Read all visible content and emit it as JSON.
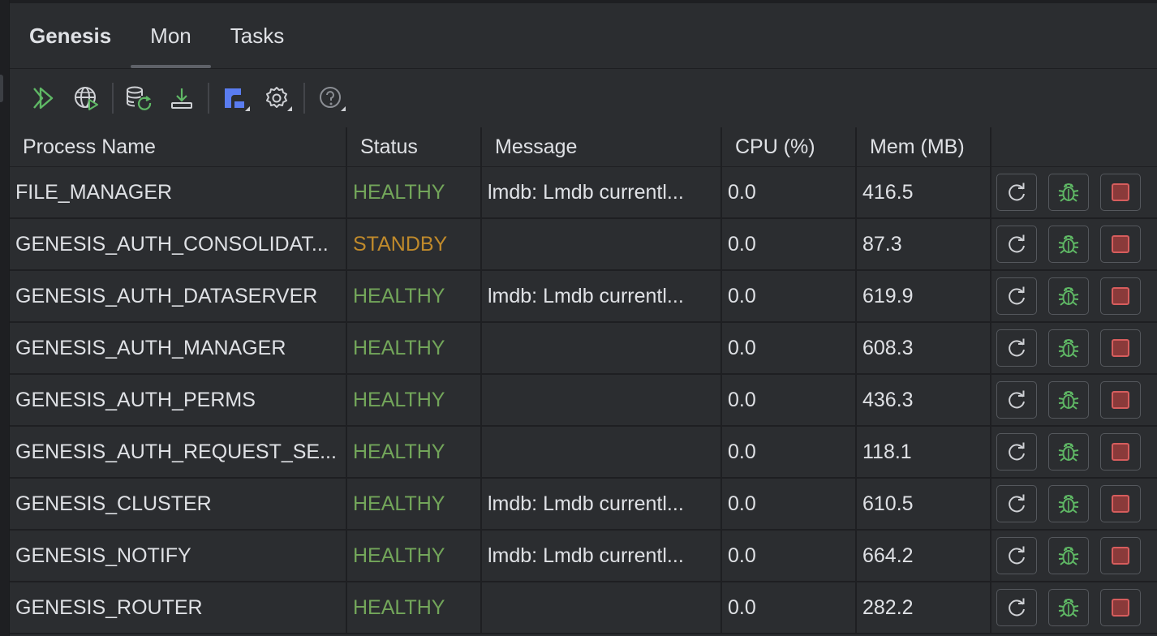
{
  "tabs": [
    {
      "label": "Genesis"
    },
    {
      "label": "Mon"
    },
    {
      "label": "Tasks"
    }
  ],
  "toolbar": {
    "icons": [
      "run-all-icon",
      "web-run-icon",
      "database-refresh-icon",
      "download-icon",
      "cluster-view-icon",
      "settings-icon",
      "help-icon"
    ]
  },
  "columns": {
    "process_name": "Process Name",
    "status": "Status",
    "message": "Message",
    "cpu": "CPU (%)",
    "mem": "Mem (MB)"
  },
  "rows": [
    {
      "name": "FILE_MANAGER",
      "status": "HEALTHY",
      "message": "lmdb: Lmdb currentl...",
      "cpu": "0.0",
      "mem": "416.5"
    },
    {
      "name": "GENESIS_AUTH_CONSOLIDAT...",
      "status": "STANDBY",
      "message": "",
      "cpu": "0.0",
      "mem": "87.3"
    },
    {
      "name": "GENESIS_AUTH_DATASERVER",
      "status": "HEALTHY",
      "message": "lmdb: Lmdb currentl...",
      "cpu": "0.0",
      "mem": "619.9"
    },
    {
      "name": "GENESIS_AUTH_MANAGER",
      "status": "HEALTHY",
      "message": "",
      "cpu": "0.0",
      "mem": "608.3"
    },
    {
      "name": "GENESIS_AUTH_PERMS",
      "status": "HEALTHY",
      "message": "",
      "cpu": "0.0",
      "mem": "436.3"
    },
    {
      "name": "GENESIS_AUTH_REQUEST_SE...",
      "status": "HEALTHY",
      "message": "",
      "cpu": "0.0",
      "mem": "118.1"
    },
    {
      "name": "GENESIS_CLUSTER",
      "status": "HEALTHY",
      "message": "lmdb: Lmdb currentl...",
      "cpu": "0.0",
      "mem": "610.5"
    },
    {
      "name": "GENESIS_NOTIFY",
      "status": "HEALTHY",
      "message": "lmdb: Lmdb currentl...",
      "cpu": "0.0",
      "mem": "664.2"
    },
    {
      "name": "GENESIS_ROUTER",
      "status": "HEALTHY",
      "message": "",
      "cpu": "0.0",
      "mem": "282.2"
    }
  ],
  "colors": {
    "healthy": "#73a65a",
    "standby": "#c08a2b",
    "accent_blue": "#5a7cf0",
    "stop_red": "#d65d5d"
  }
}
